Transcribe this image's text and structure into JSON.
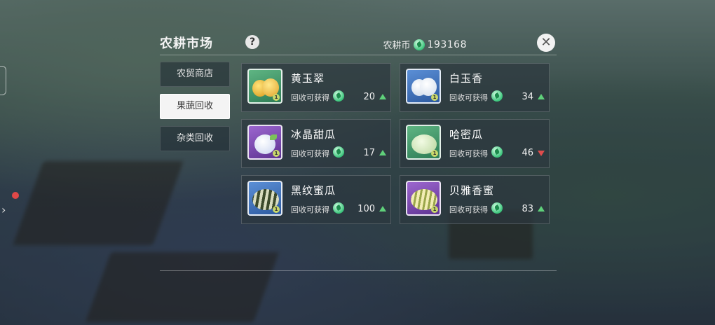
{
  "window": {
    "title": "农耕市场"
  },
  "currency": {
    "label": "农耕币",
    "value": "193168",
    "icon": "leaf-coin-icon"
  },
  "tabs": [
    {
      "label": "农贸商店",
      "active": false
    },
    {
      "label": "果蔬回收",
      "active": true
    },
    {
      "label": "杂类回收",
      "active": false
    }
  ],
  "items": [
    {
      "name": "黄玉翠",
      "recv_label": "回收可获得",
      "amount": "20",
      "trend": "up",
      "bg": "green"
    },
    {
      "name": "白玉香",
      "recv_label": "回收可获得",
      "amount": "34",
      "trend": "up",
      "bg": "blue"
    },
    {
      "name": "冰晶甜瓜",
      "recv_label": "回收可获得",
      "amount": "17",
      "trend": "up",
      "bg": "purple"
    },
    {
      "name": "哈密瓜",
      "recv_label": "回收可获得",
      "amount": "46",
      "trend": "down",
      "bg": "green"
    },
    {
      "name": "黑纹蜜瓜",
      "recv_label": "回收可获得",
      "amount": "100",
      "trend": "up",
      "bg": "blue"
    },
    {
      "name": "贝雅香蜜",
      "recv_label": "回收可获得",
      "amount": "83",
      "trend": "up",
      "bg": "purple"
    }
  ],
  "colors": {
    "trend_up": "#5fd07a",
    "trend_down": "#e04c4c",
    "active_tab": "#f4f4f4"
  }
}
